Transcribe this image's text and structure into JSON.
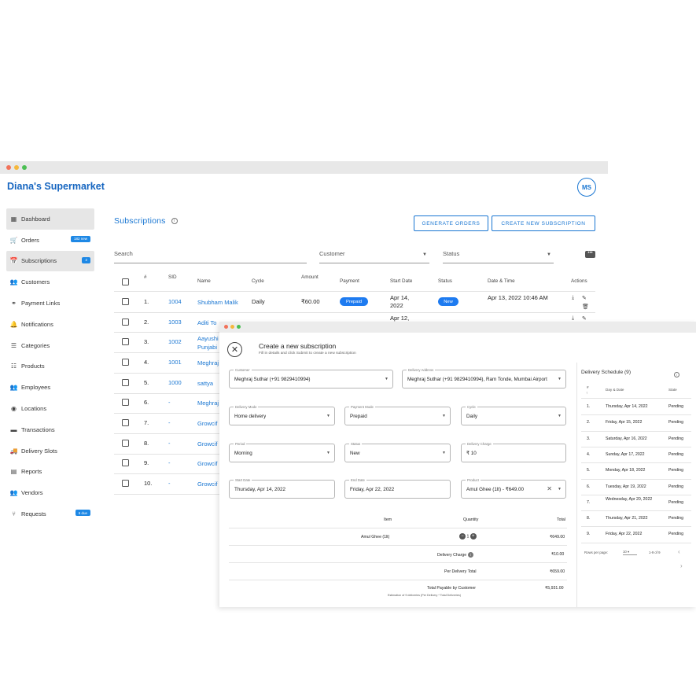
{
  "app": {
    "brand": "Diana's Supermarket",
    "avatar_initials": "MS"
  },
  "sidebar": {
    "items": [
      {
        "label": "Dashboard",
        "icon": "dashboard-icon",
        "glyph": "▦",
        "badge": ""
      },
      {
        "label": "Orders",
        "icon": "cart-icon",
        "glyph": "🛒",
        "badge": "182 new"
      },
      {
        "label": "Subscriptions",
        "icon": "calendar-icon",
        "glyph": "📅",
        "badge": "2"
      },
      {
        "label": "Customers",
        "icon": "people-icon",
        "glyph": "👥",
        "badge": ""
      },
      {
        "label": "Payment Links",
        "icon": "link-icon",
        "glyph": "⚭",
        "badge": ""
      },
      {
        "label": "Notifications",
        "icon": "bell-icon",
        "glyph": "🔔",
        "badge": ""
      },
      {
        "label": "Categories",
        "icon": "list-icon",
        "glyph": "☰",
        "badge": ""
      },
      {
        "label": "Products",
        "icon": "products-icon",
        "glyph": "☷",
        "badge": ""
      },
      {
        "label": "Employees",
        "icon": "employees-icon",
        "glyph": "👥",
        "badge": ""
      },
      {
        "label": "Locations",
        "icon": "location-icon",
        "glyph": "◉",
        "badge": ""
      },
      {
        "label": "Transactions",
        "icon": "card-icon",
        "glyph": "▬",
        "badge": ""
      },
      {
        "label": "Delivery Slots",
        "icon": "truck-icon",
        "glyph": "🚚",
        "badge": ""
      },
      {
        "label": "Reports",
        "icon": "report-icon",
        "glyph": "▤",
        "badge": ""
      },
      {
        "label": "Vendors",
        "icon": "vendors-icon",
        "glyph": "👥",
        "badge": ""
      },
      {
        "label": "Requests",
        "icon": "branch-icon",
        "glyph": "⑂",
        "badge": "6 due"
      }
    ]
  },
  "subscriptions": {
    "title": "Subscriptions",
    "generate_orders": "GENERATE ORDERS",
    "create_new": "CREATE NEW SUBSCRIPTION",
    "filters": {
      "search": "Search",
      "customer": "Customer",
      "status": "Status"
    },
    "columns": [
      "#",
      "SID",
      "Name",
      "Cycle",
      "Amount",
      "Payment",
      "Start Date",
      "Status",
      "Date & Time",
      "Actions"
    ],
    "rows": [
      {
        "num": "1.",
        "sid": "1004",
        "name": "Shubham Malik",
        "cycle": "Daily",
        "amount": "₹60.00",
        "payment": "Prepaid",
        "start": "Apr 14, 2022",
        "status": "New",
        "datetime": "Apr 13, 2022 10:46 AM"
      },
      {
        "num": "2.",
        "sid": "1003",
        "name": "Aditi To",
        "cycle": "",
        "amount": "",
        "payment": "",
        "start": "Apr 12,",
        "status": "",
        "datetime": ""
      },
      {
        "num": "3.",
        "sid": "1002",
        "name": "Aayushi Punjabi"
      },
      {
        "num": "4.",
        "sid": "1001",
        "name": "Meghraj"
      },
      {
        "num": "5.",
        "sid": "1000",
        "name": "sattya"
      },
      {
        "num": "6.",
        "sid": "-",
        "name": "Meghraj"
      },
      {
        "num": "7.",
        "sid": "-",
        "name": "Growcif"
      },
      {
        "num": "8.",
        "sid": "-",
        "name": "Growcif"
      },
      {
        "num": "9.",
        "sid": "-",
        "name": "Growcif"
      },
      {
        "num": "10.",
        "sid": "-",
        "name": "Growcif"
      }
    ]
  },
  "modal": {
    "title": "Create a new subscription",
    "subtitle": "Fill in details and click Submit to create a new subscription",
    "fields": {
      "customer": {
        "label": "Customer",
        "value": "Meghraj Suthar (+91 9829410994)"
      },
      "address": {
        "label": "Delivery Address",
        "value": "Meghraj Suthar (+91 9829410994), Ram Tonde,  Mumbai Airport"
      },
      "delivery_mode": {
        "label": "Delivery Mode",
        "value": "Home delivery"
      },
      "payment_mode": {
        "label": "Payment Mode",
        "value": "Prepaid"
      },
      "cycle": {
        "label": "Cycle",
        "value": "Daily"
      },
      "period": {
        "label": "Period",
        "value": "Morning"
      },
      "status": {
        "label": "Status",
        "value": "New"
      },
      "delivery_charge": {
        "label": "Delivery Charge",
        "value": "₹ 10"
      },
      "start_date": {
        "label": "Start Date",
        "value": "Thursday, Apr 14, 2022"
      },
      "end_date": {
        "label": "End Date",
        "value": "Friday, Apr 22, 2022"
      },
      "product": {
        "label": "Product",
        "value": "Amul Ghee (1lt) - ₹649.00"
      }
    },
    "summary": {
      "col_item": "Item",
      "col_qty": "Quantity",
      "col_total": "Total",
      "item_name": "Amul Ghee (1lt)",
      "item_qty": "1",
      "item_total": "₹649.00",
      "delivery_label": "Delivery Charge",
      "delivery_total": "₹10.00",
      "per_delivery_label": "Per Delivery Total",
      "per_delivery_total": "₹659.00",
      "payable_label": "Total Payable by Customer",
      "payable_total": "₹5,931.00",
      "payable_note": "Estimation of 9 deliveries (Per Delivery * Total Deliveries)"
    },
    "schedule": {
      "title": "Delivery Schedule (9)",
      "col_num": "#",
      "col_day": "Day & Date",
      "col_state": "State",
      "rows": [
        {
          "num": "1.",
          "day": "Thursday, Apr 14, 2022",
          "state": "Pending"
        },
        {
          "num": "2.",
          "day": "Friday, Apr 15, 2022",
          "state": "Pending"
        },
        {
          "num": "3.",
          "day": "Saturday, Apr 16, 2022",
          "state": "Pending"
        },
        {
          "num": "4.",
          "day": "Sunday, Apr 17, 2022",
          "state": "Pending"
        },
        {
          "num": "5.",
          "day": "Monday, Apr 18, 2022",
          "state": "Pending"
        },
        {
          "num": "6.",
          "day": "Tuesday, Apr 19, 2022",
          "state": "Pending"
        },
        {
          "num": "7.",
          "day": "Wednesday, Apr 20, 2022",
          "state": "Pending"
        },
        {
          "num": "8.",
          "day": "Thursday, Apr 21, 2022",
          "state": "Pending"
        },
        {
          "num": "9.",
          "day": "Friday, Apr 22, 2022",
          "state": "Pending"
        }
      ],
      "rows_per_page_label": "Rows per page:",
      "rows_per_page": "10",
      "page_info": "1-9 of 9"
    }
  }
}
